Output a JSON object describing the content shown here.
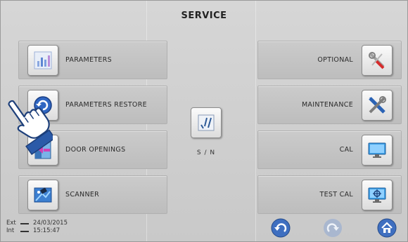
{
  "header": {
    "title": "SERVICE"
  },
  "left_buttons": [
    {
      "label": "PARAMETERS",
      "icon": "bar-chart-icon"
    },
    {
      "label": "PARAMETERS RESTORE",
      "icon": "restore-globe-icon"
    },
    {
      "label": "DOOR OPENINGS",
      "icon": "door-icon"
    },
    {
      "label": "SCANNER",
      "icon": "scanner-icon"
    }
  ],
  "right_buttons": [
    {
      "label": "OPTIONAL",
      "icon": "tools-icon"
    },
    {
      "label": "MAINTENANCE",
      "icon": "wrench-screwdriver-icon"
    },
    {
      "label": "CAL",
      "icon": "monitor-icon"
    },
    {
      "label": "TEST CAL",
      "icon": "target-monitor-icon"
    }
  ],
  "center": {
    "sn_label": "S / N",
    "icon": "checklist-icon"
  },
  "status": {
    "ext_label": "Ext",
    "ext_value": "24/03/2015",
    "int_label": "Int",
    "int_value": "15:15:47"
  },
  "nav": {
    "back_icon": "back-arrow-icon",
    "forward_icon": "forward-arrow-icon",
    "home_icon": "home-icon"
  },
  "colors": {
    "background": "#cfcfcf",
    "button": "#c4c4c4",
    "nav_blue": "#3f6fc0",
    "nav_disabled": "#a9b7cf"
  }
}
